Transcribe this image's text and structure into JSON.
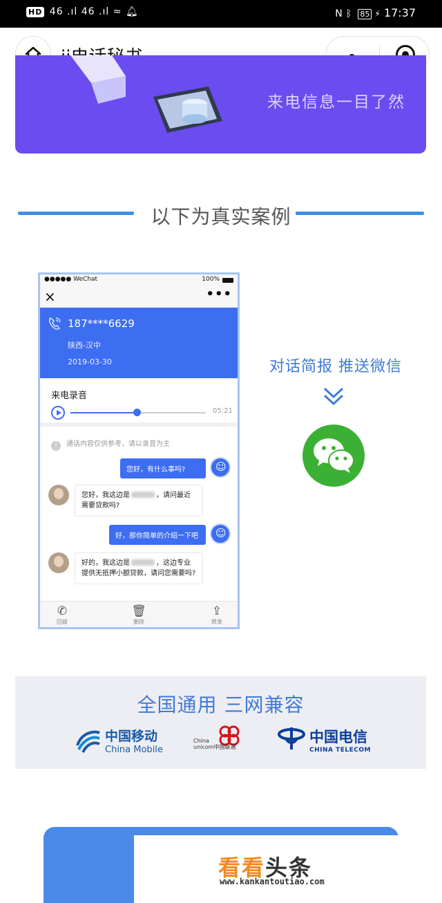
{
  "status_bar": {
    "left_text": "46 .ıl 46 .ıl",
    "hd_label": "HD",
    "battery": "85",
    "time": "17:37"
  },
  "title_bar": {
    "title": "ii电话秘书"
  },
  "banner": {
    "line1": "来电信息一目了然"
  },
  "section": {
    "title": "以下为真实案例"
  },
  "phone_mock": {
    "status_left": "●●●●● WeChat",
    "status_right": "100%",
    "close_icon": "×",
    "more_icon": "•••",
    "caller_number": "187****6629",
    "location": "陕西-汉中",
    "date": "2019-03-30",
    "recording_title": "来电录音",
    "duration": "05:21",
    "progress": 0.49,
    "note_icon": "!",
    "note": "通话内容仅供参考，请以录音为主",
    "messages": [
      {
        "side": "right",
        "text": "您好，有什么事吗?"
      },
      {
        "side": "left",
        "text_before": "您好，我这边是",
        "text_after": "，请问最近需要贷款吗?"
      },
      {
        "side": "right",
        "text": "好，那你简单的介绍一下吧"
      },
      {
        "side": "left",
        "text_before": "好的，我这边是",
        "text_after": "，这边专业提供无抵押小额贷款，请问您需要吗?"
      }
    ],
    "bottom_tabs": [
      {
        "icon": "✆",
        "label": "回拨"
      },
      {
        "icon": "🗑",
        "label": "删除"
      },
      {
        "icon": "⇪",
        "label": "转发"
      }
    ]
  },
  "case_side": {
    "tagline": "对话简报 推送微信"
  },
  "carriers": {
    "title": "全国通用 三网兼容",
    "china_mobile_cn": "中国移动",
    "china_mobile_en": "China Mobile",
    "unicom_en1": "China",
    "unicom_en2": "unicom中国联通",
    "telecom_cn": "中国电信",
    "telecom_en": "CHINA TELECOM"
  },
  "watermark": {
    "part1": "看看",
    "part2": "头条",
    "url": "www.kankantoutiao.com"
  },
  "colors": {
    "banner_purple": "#6a4cf0",
    "accent_blue": "#3d6df1",
    "heading_blue": "#3f7bd8",
    "wechat_green": "#3cb035"
  }
}
